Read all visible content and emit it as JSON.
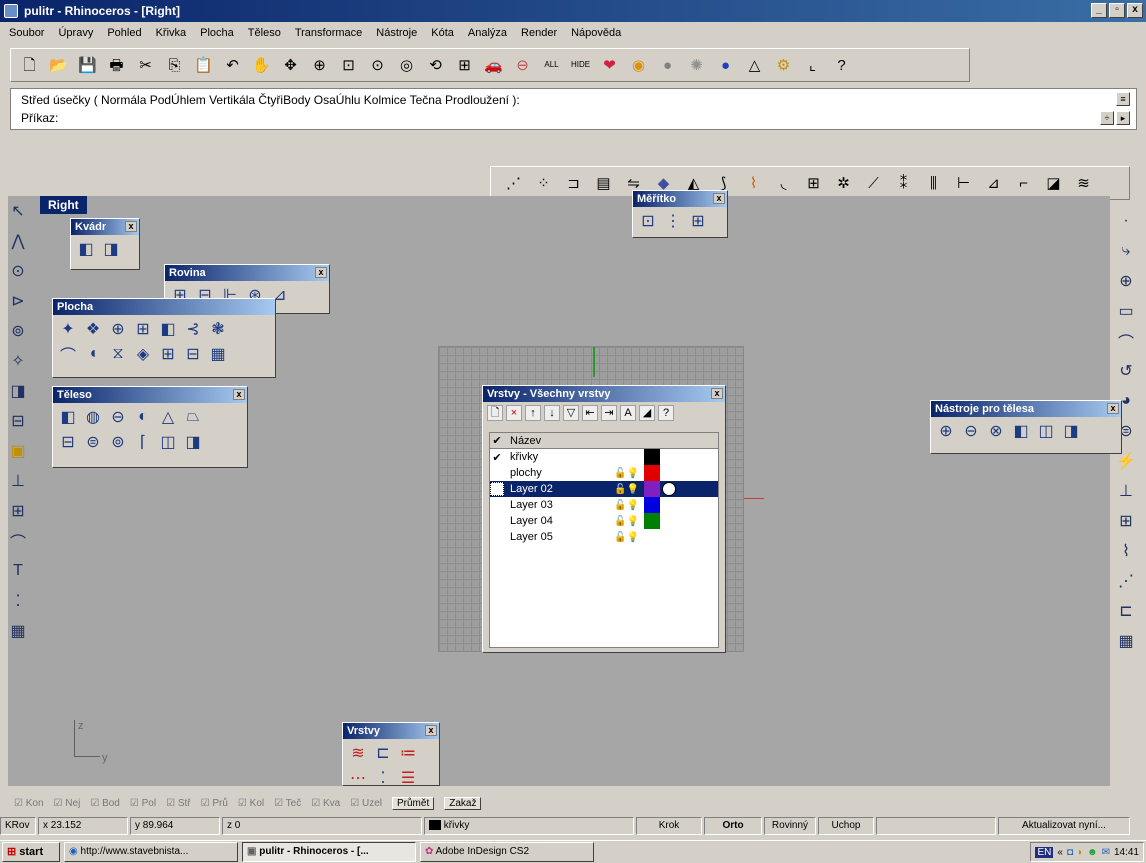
{
  "window": {
    "title": "pulitr - Rhinoceros - [Right]",
    "buttons": [
      "_",
      "▫",
      "x"
    ]
  },
  "menu": [
    "Soubor",
    "Úpravy",
    "Pohled",
    "Křivka",
    "Plocha",
    "Těleso",
    "Transformace",
    "Nástroje",
    "Kóta",
    "Analýza",
    "Render",
    "Nápověda"
  ],
  "command": {
    "history": "Střed úsečky ( Normála  PodÚhlem  Vertikála  ČtyřiBody  OsaÚhlu  Kolmice  Tečna  Prodloužení ):",
    "prompt": "Příkaz:"
  },
  "toolbar_icons": [
    "new-file",
    "open",
    "save",
    "print",
    "cut",
    "copy",
    "paste",
    "undo",
    "pan",
    "rotate-view",
    "zoom",
    "zoom-window",
    "zoom-extents",
    "zoom-selected",
    "redo-view",
    "grid",
    "show",
    "hide",
    "lock",
    "unlock",
    "shade",
    "render",
    "material",
    "light",
    "point",
    "options",
    "help"
  ],
  "toolbar_text": {
    "all": "ALL",
    "hide": "HIDE"
  },
  "viewport": {
    "label": "Right",
    "axis_z": "z",
    "axis_y": "y"
  },
  "panels": {
    "kvadr": {
      "title": "Kvádr"
    },
    "rovina": {
      "title": "Rovina"
    },
    "plocha": {
      "title": "Plocha"
    },
    "teleso": {
      "title": "Těleso"
    },
    "meritko": {
      "title": "Měřítko"
    },
    "nastroje": {
      "title": "Nástroje pro tělesa"
    },
    "vrstvy_small": {
      "title": "Vrstvy"
    },
    "close": "x"
  },
  "layers_panel": {
    "title": "Vrstvy - Všechny vrstvy",
    "column_name": "Název",
    "rows": [
      {
        "name": "křivky",
        "current": true,
        "color": "#000000",
        "selected": false
      },
      {
        "name": "plochy",
        "current": false,
        "color": "#e00000",
        "selected": false
      },
      {
        "name": "Layer 02",
        "current": false,
        "color": "#8020c0",
        "selected": true
      },
      {
        "name": "Layer 03",
        "current": false,
        "color": "#0000e0",
        "selected": false
      },
      {
        "name": "Layer 04",
        "current": false,
        "color": "#008000",
        "selected": false
      },
      {
        "name": "Layer 05",
        "current": false,
        "color": "#ffffff",
        "selected": false
      }
    ]
  },
  "snaps": [
    "Kon",
    "Nej",
    "Bod",
    "Pol",
    "Stř",
    "Prů",
    "Kol",
    "Teč",
    "Kva",
    "Uzel"
  ],
  "snap_buttons": {
    "prumet": "Průmět",
    "zakaz": "Zakaž"
  },
  "status": {
    "cplane": "KRov",
    "x": "x 23.152",
    "y": "y 89.964",
    "z": "z 0",
    "layer": "křivky",
    "krok": "Krok",
    "orto": "Orto",
    "rovinny": "Rovinný",
    "uchop": "Uchop",
    "update": "Aktualizovat nyní..."
  },
  "taskbar": {
    "start": "start",
    "tasks": [
      "http://www.stavebnista...",
      "pulitr - Rhinoceros - [...",
      "Adobe InDesign CS2"
    ],
    "lang": "EN",
    "time": "14:41"
  }
}
